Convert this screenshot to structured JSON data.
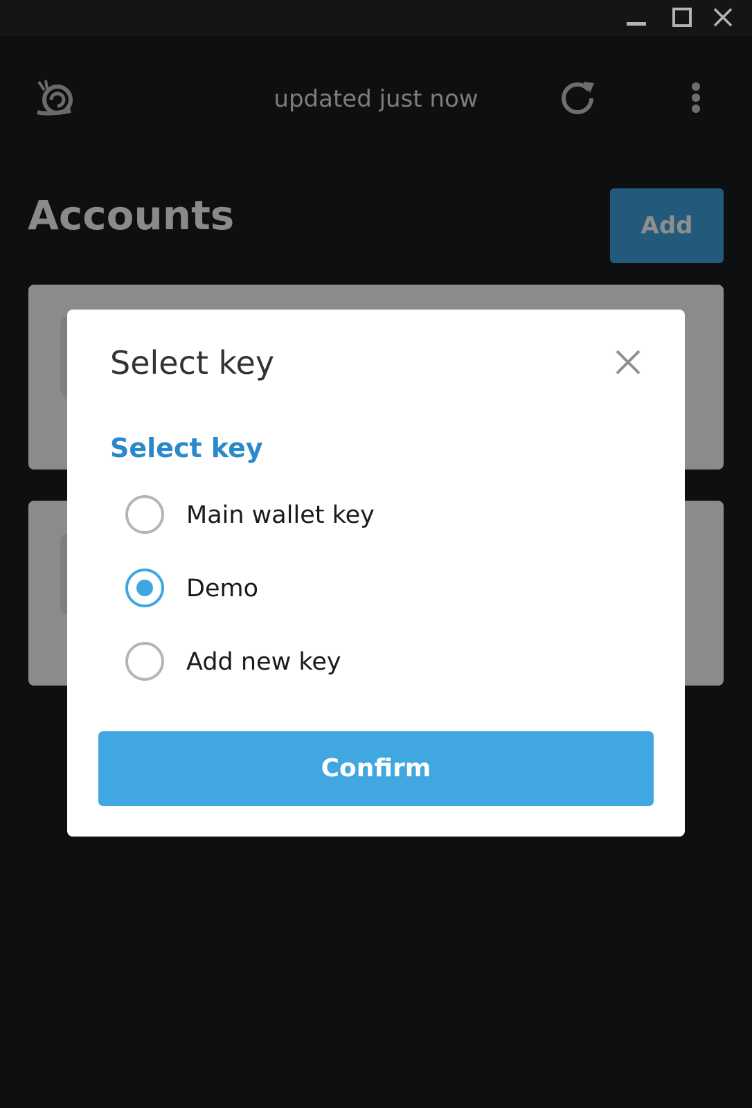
{
  "window_controls": {
    "minimize_icon": "minimize-icon",
    "maximize_icon": "maximize-icon",
    "close_icon": "close-icon"
  },
  "header": {
    "status": "updated just now",
    "logo_icon": "snail-logo-icon",
    "refresh_icon": "refresh-icon",
    "menu_icon": "more-vertical-icon"
  },
  "page": {
    "title": "Accounts",
    "add_label": "Add"
  },
  "modal": {
    "title": "Select key",
    "section_label": "Select key",
    "options": [
      {
        "label": "Main wallet key",
        "selected": false
      },
      {
        "label": "Demo",
        "selected": true
      },
      {
        "label": "Add new key",
        "selected": false
      }
    ],
    "confirm_label": "Confirm"
  },
  "colors": {
    "accent": "#41a7e1",
    "section_label": "#2a8ac9",
    "overlay_bg": "#0e0f11"
  }
}
